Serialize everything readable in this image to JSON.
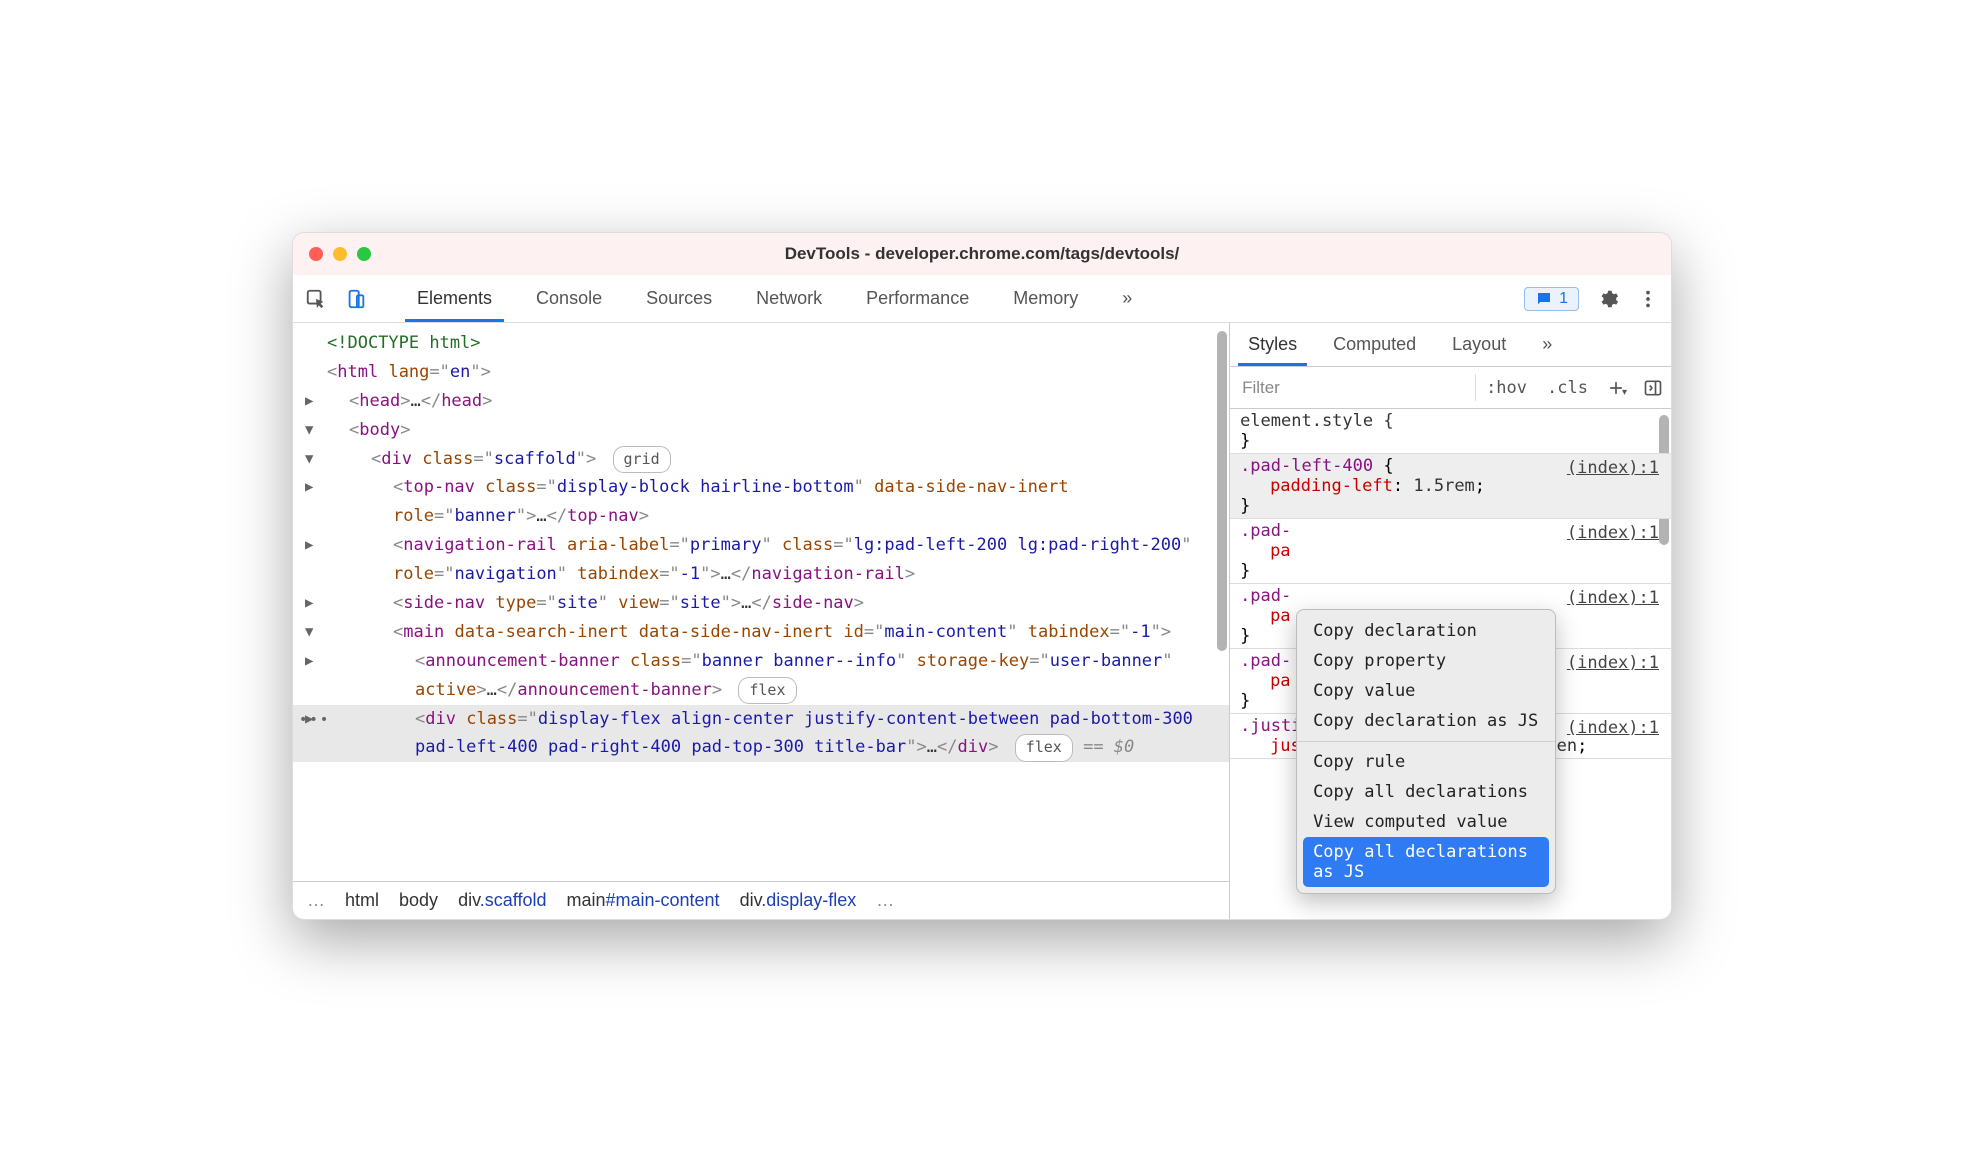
{
  "window": {
    "title": "DevTools - developer.chrome.com/tags/devtools/"
  },
  "toolbar": {
    "tabs": [
      "Elements",
      "Console",
      "Sources",
      "Network",
      "Performance",
      "Memory"
    ],
    "active_tab": "Elements",
    "more_glyph": "»",
    "issues_count": "1"
  },
  "dom": {
    "doctype": "<!DOCTYPE html>",
    "scaffold_badge": "grid",
    "banner_badge": "flex",
    "selected_badge": "flex",
    "selected_suffix": "== $0"
  },
  "breadcrumb": {
    "leading_ell": "…",
    "segments": [
      "html",
      "body",
      "div.scaffold",
      "main#main-content",
      "div.display-flex"
    ],
    "trailing_ell": "…"
  },
  "styles": {
    "tabs": [
      "Styles",
      "Computed",
      "Layout"
    ],
    "more_glyph": "»",
    "active_tab": "Styles",
    "filter_placeholder": "Filter",
    "hov_label": ":hov",
    "cls_label": ".cls",
    "rules": [
      {
        "type": "element",
        "head": "element.style {",
        "declarations": [],
        "close": "}"
      },
      {
        "type": "rule",
        "selector": ".pad-left-400",
        "src": "(index):1",
        "hover": true,
        "declarations": [
          {
            "prop": "padding-left",
            "val": "1.5rem"
          }
        ]
      },
      {
        "type": "rule",
        "selector": ".pad-",
        "src": "(index):1",
        "declarations": [
          {
            "prop": "pa",
            "val": ""
          }
        ]
      },
      {
        "type": "rule",
        "selector": ".pad-",
        "src": "(index):1",
        "declarations": [
          {
            "prop": "pa",
            "val": ""
          }
        ]
      },
      {
        "type": "rule",
        "selector": ".pad-",
        "src": "(index):1",
        "declarations": [
          {
            "prop": "pa",
            "val": ""
          }
        ]
      },
      {
        "type": "rule",
        "selector": ".justify-content-between",
        "src": "(index):1",
        "declarations": [
          {
            "prop": "justify-content",
            "val": "space-between"
          }
        ],
        "no_close": true
      }
    ]
  },
  "context_menu": {
    "items": [
      "Copy declaration",
      "Copy property",
      "Copy value",
      "Copy declaration as JS",
      "---",
      "Copy rule",
      "Copy all declarations",
      "View computed value",
      "Copy all declarations as JS"
    ],
    "selected": "Copy all declarations as JS"
  }
}
